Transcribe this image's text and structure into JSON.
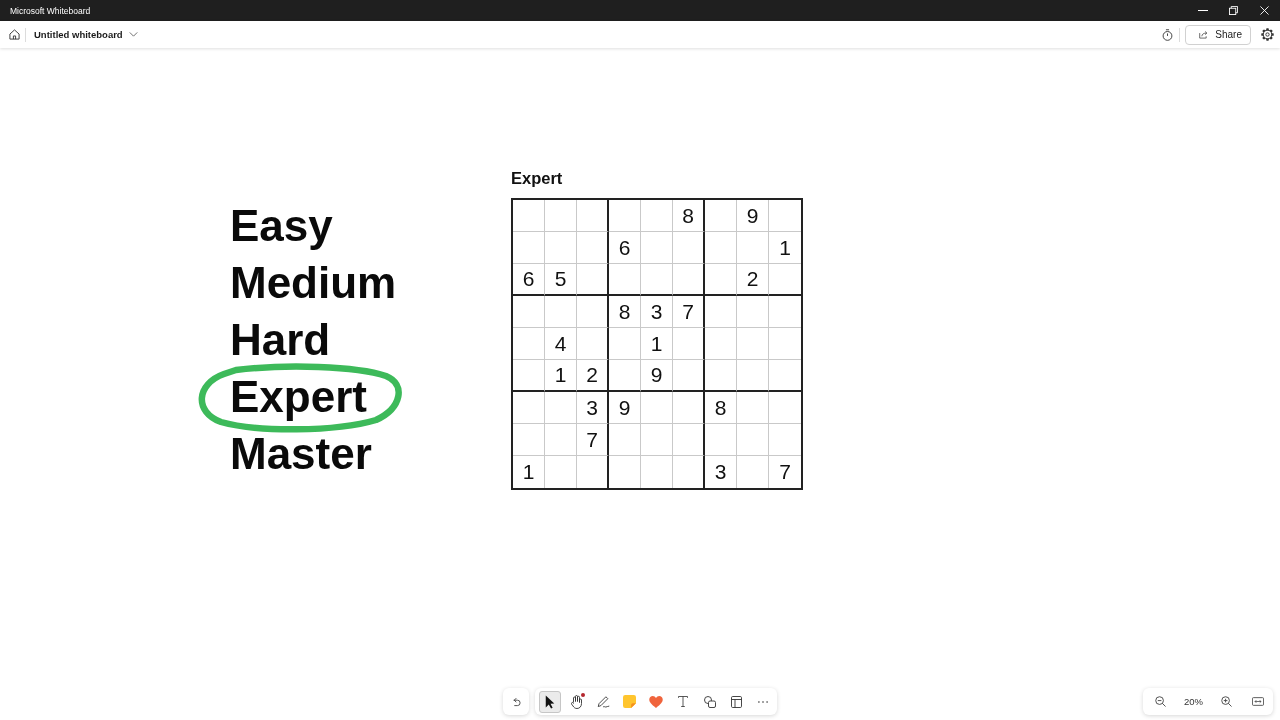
{
  "window": {
    "title": "Microsoft Whiteboard"
  },
  "header": {
    "board_title": "Untitled whiteboard",
    "share_label": "Share"
  },
  "canvas": {
    "levels": [
      {
        "label": "Easy",
        "circled": false
      },
      {
        "label": "Medium",
        "circled": false
      },
      {
        "label": "Hard",
        "circled": false
      },
      {
        "label": "Expert",
        "circled": true
      },
      {
        "label": "Master",
        "circled": false
      }
    ],
    "puzzle": {
      "title": "Expert",
      "rows": [
        [
          null,
          null,
          null,
          null,
          null,
          "8",
          null,
          "9",
          null
        ],
        [
          null,
          null,
          null,
          "6",
          null,
          null,
          null,
          null,
          "1"
        ],
        [
          "6",
          "5",
          null,
          null,
          null,
          null,
          null,
          "2",
          null
        ],
        [
          null,
          null,
          null,
          "8",
          "3",
          "7",
          null,
          null,
          null
        ],
        [
          null,
          "4",
          null,
          null,
          "1",
          null,
          null,
          null,
          null
        ],
        [
          null,
          "1",
          "2",
          null,
          "9",
          null,
          null,
          null,
          null
        ],
        [
          null,
          null,
          "3",
          "9",
          null,
          null,
          "8",
          null,
          null
        ],
        [
          null,
          null,
          "7",
          null,
          null,
          null,
          null,
          null,
          null
        ],
        [
          "1",
          null,
          null,
          null,
          null,
          null,
          "3",
          null,
          "7"
        ]
      ]
    }
  },
  "toolbar": {
    "tools": [
      {
        "kind": "select",
        "selected": true,
        "alert": false
      },
      {
        "kind": "hand",
        "selected": false,
        "alert": true
      },
      {
        "kind": "pen",
        "selected": false,
        "alert": false
      },
      {
        "kind": "note",
        "selected": false,
        "alert": false
      },
      {
        "kind": "reaction",
        "selected": false,
        "alert": false
      },
      {
        "kind": "text",
        "selected": false,
        "alert": false
      },
      {
        "kind": "shapes",
        "selected": false,
        "alert": false
      },
      {
        "kind": "template",
        "selected": false,
        "alert": false
      },
      {
        "kind": "more",
        "selected": false,
        "alert": false
      }
    ]
  },
  "zoom": {
    "value": "20%"
  }
}
